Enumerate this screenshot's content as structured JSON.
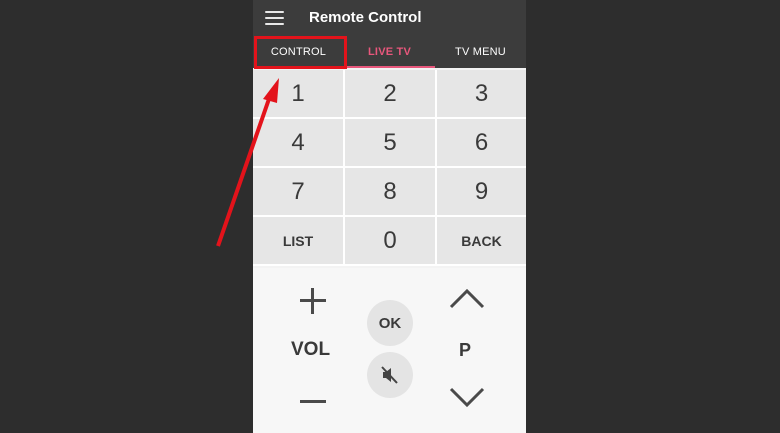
{
  "appbar": {
    "menu_icon": "hamburger-menu-icon",
    "title": "Remote Control"
  },
  "tabs": [
    {
      "label": "CONTROL",
      "active": false
    },
    {
      "label": "LIVE TV",
      "active": true
    },
    {
      "label": "TV MENU",
      "active": false
    }
  ],
  "keypad": {
    "keys": [
      "1",
      "2",
      "3",
      "4",
      "5",
      "6",
      "7",
      "8",
      "9",
      "LIST",
      "0",
      "BACK"
    ]
  },
  "controls": {
    "vol_label": "VOL",
    "vol_up_icon": "plus-icon",
    "vol_down_icon": "minus-icon",
    "ok_label": "OK",
    "mute_icon": "mute-icon",
    "channel_label": "P",
    "channel_up_icon": "chevron-up-icon",
    "channel_down_icon": "chevron-down-icon"
  },
  "colors": {
    "accent": "#e8577c",
    "appbar": "#3c3c3c",
    "annotation": "#e3131b",
    "background": "#2d2d2d"
  }
}
